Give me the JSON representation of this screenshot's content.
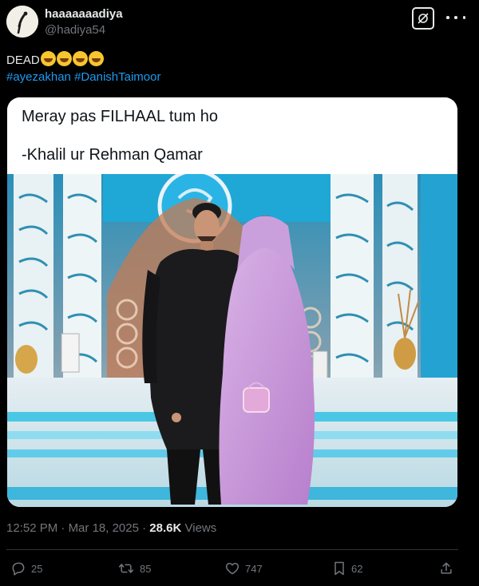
{
  "user": {
    "display_name": "haaaaaaadiya",
    "handle": "@hadiya54"
  },
  "tweet": {
    "text": "DEAD",
    "emoji": "rolling-on-floor-laughing",
    "emoji_count": 4,
    "hashtags": [
      "#ayezakhan",
      "#DanishTaimoor"
    ]
  },
  "media": {
    "quote_line1": "Meray pas FILHAAL tum ho",
    "quote_line2": "-Khalil ur Rehman Qamar"
  },
  "meta": {
    "time": "12:52 PM",
    "date": "Mar 18, 2025",
    "views_count": "28.6K",
    "views_label": "Views"
  },
  "actions": {
    "replies": "25",
    "reposts": "85",
    "likes": "747",
    "bookmarks": "62"
  },
  "icons": {
    "reply": "reply-icon",
    "repost": "repost-icon",
    "like": "heart-icon",
    "bookmark": "bookmark-icon",
    "share": "share-icon",
    "grok": "grok-icon",
    "more": "more-icon"
  },
  "colors": {
    "background": "#000000",
    "text": "#e7e9ea",
    "muted": "#71767b",
    "link": "#1d9bf0",
    "divider": "#2f3336"
  }
}
